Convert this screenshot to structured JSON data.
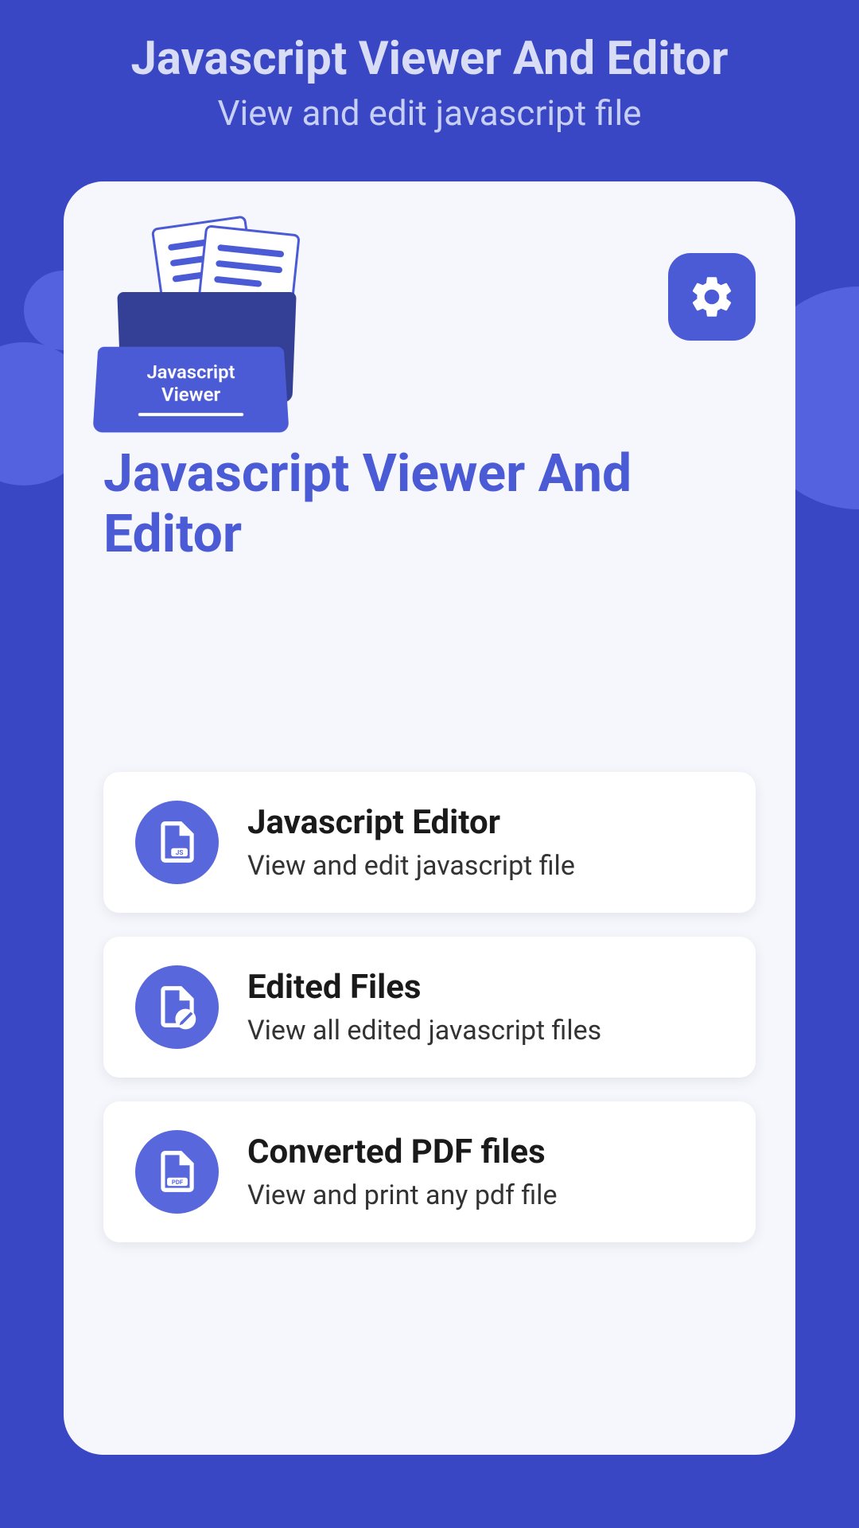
{
  "header": {
    "title": "Javascript Viewer And Editor",
    "subtitle": "View and edit javascript file"
  },
  "card": {
    "folder_label": "Javascript\nViewer",
    "title": "Javascript Viewer And Editor"
  },
  "menu_items": [
    {
      "title": "Javascript Editor",
      "subtitle": "View and edit javascript file",
      "icon": "js-file-icon"
    },
    {
      "title": "Edited Files",
      "subtitle": "View all edited javascript files",
      "icon": "file-edit-icon"
    },
    {
      "title": "Converted PDF files",
      "subtitle": "View and print any pdf file",
      "icon": "pdf-file-icon"
    }
  ]
}
